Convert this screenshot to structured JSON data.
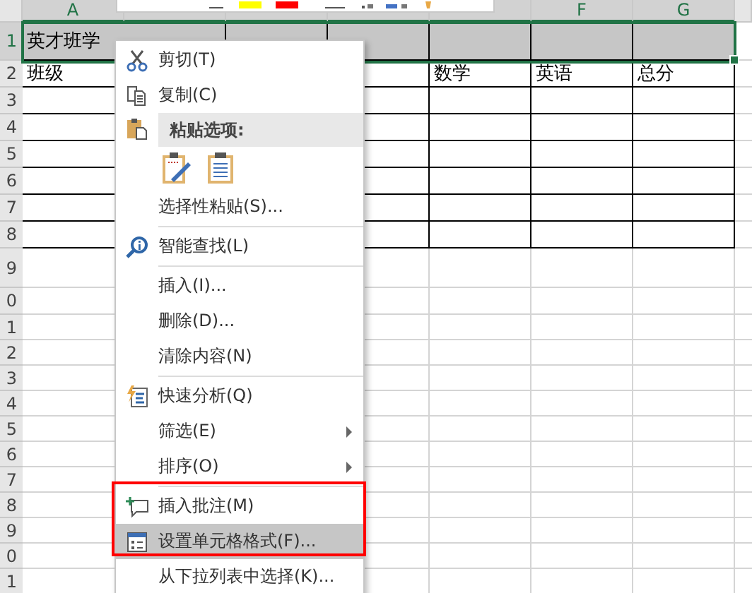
{
  "sheet": {
    "columns": [
      {
        "header": "A"
      },
      {},
      {},
      {},
      {},
      {
        "header": "F"
      },
      {
        "header": "G"
      }
    ],
    "rows": [
      {
        "label": "1",
        "selected": true,
        "bordered": true,
        "cells": [
          "英才班学",
          null,
          null,
          null,
          null,
          null,
          null
        ]
      },
      {
        "label": "2",
        "selected": false,
        "bordered": true,
        "cells": [
          "班级",
          null,
          null,
          null,
          "数学",
          "英语",
          "总分"
        ]
      },
      {
        "label": "3",
        "selected": false,
        "bordered": true,
        "cells": []
      },
      {
        "label": "4",
        "selected": false,
        "bordered": true,
        "cells": []
      },
      {
        "label": "5",
        "selected": false,
        "bordered": true,
        "cells": []
      },
      {
        "label": "6",
        "selected": false,
        "bordered": true,
        "cells": []
      },
      {
        "label": "7",
        "selected": false,
        "bordered": true,
        "cells": []
      },
      {
        "label": "8",
        "selected": false,
        "bordered": true,
        "cells": []
      },
      {
        "label": "9",
        "selected": false,
        "bordered": false,
        "cells": []
      },
      {
        "label": "0",
        "selected": false,
        "bordered": false,
        "cells": []
      },
      {
        "label": "1",
        "selected": false,
        "bordered": false,
        "cells": []
      },
      {
        "label": "2",
        "selected": false,
        "bordered": false,
        "cells": []
      },
      {
        "label": "3",
        "selected": false,
        "bordered": false,
        "cells": []
      },
      {
        "label": "4",
        "selected": false,
        "bordered": false,
        "cells": []
      },
      {
        "label": "5",
        "selected": false,
        "bordered": false,
        "cells": []
      },
      {
        "label": "6",
        "selected": false,
        "bordered": false,
        "cells": []
      },
      {
        "label": "7",
        "selected": false,
        "bordered": false,
        "cells": []
      },
      {
        "label": "8",
        "selected": false,
        "bordered": false,
        "cells": []
      },
      {
        "label": "9",
        "selected": false,
        "bordered": false,
        "cells": []
      },
      {
        "label": "0",
        "selected": false,
        "bordered": false,
        "cells": []
      },
      {
        "label": "1",
        "selected": false,
        "bordered": false,
        "cells": []
      }
    ]
  },
  "mini_toolbar": {
    "swatches": [
      {
        "color": "#ffff00"
      },
      {
        "color": "#ff0000"
      }
    ]
  },
  "context_menu": {
    "items": [
      {
        "kind": "command",
        "label": "剪切(T)",
        "selected": false,
        "submenu": false
      },
      {
        "kind": "command",
        "label": "复制(C)",
        "selected": false,
        "submenu": false
      },
      {
        "kind": "header",
        "label": "粘贴选项:"
      },
      {
        "kind": "paste_icons"
      },
      {
        "kind": "command",
        "label": "选择性粘贴(S)...",
        "selected": false,
        "submenu": false
      },
      {
        "kind": "separator"
      },
      {
        "kind": "command",
        "label": "智能查找(L)",
        "selected": false,
        "submenu": false
      },
      {
        "kind": "separator"
      },
      {
        "kind": "command",
        "label": "插入(I)...",
        "selected": false,
        "submenu": false
      },
      {
        "kind": "command",
        "label": "删除(D)...",
        "selected": false,
        "submenu": false
      },
      {
        "kind": "command",
        "label": "清除内容(N)",
        "selected": false,
        "submenu": false
      },
      {
        "kind": "separator"
      },
      {
        "kind": "command",
        "label": "快速分析(Q)",
        "selected": false,
        "submenu": false
      },
      {
        "kind": "command",
        "label": "筛选(E)",
        "selected": false,
        "submenu": true
      },
      {
        "kind": "command",
        "label": "排序(O)",
        "selected": false,
        "submenu": true
      },
      {
        "kind": "separator"
      },
      {
        "kind": "command",
        "label": "插入批注(M)",
        "selected": false,
        "submenu": false
      },
      {
        "kind": "command",
        "label": "设置单元格格式(F)...",
        "selected": true,
        "submenu": false
      },
      {
        "kind": "command",
        "label": "从下拉列表中选择(K)...",
        "selected": false,
        "submenu": false
      }
    ]
  }
}
